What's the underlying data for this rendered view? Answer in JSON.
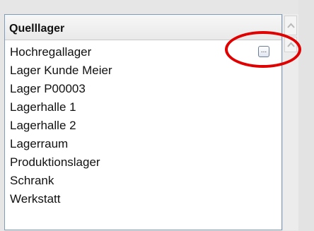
{
  "list": {
    "header": "Quelllager",
    "items": [
      "Hochregallager",
      "Lager Kunde Meier",
      "Lager P00003",
      "Lagerhalle 1",
      "Lagerhalle 2",
      "Lagerraum",
      "Produktionslager",
      "Schrank",
      "Werkstatt"
    ],
    "selected_item_button_label": "..."
  },
  "annotation": {
    "color": "#e00000",
    "shape": "ellipse"
  },
  "icons": {
    "scroll_up": "chevron-up-icon"
  }
}
